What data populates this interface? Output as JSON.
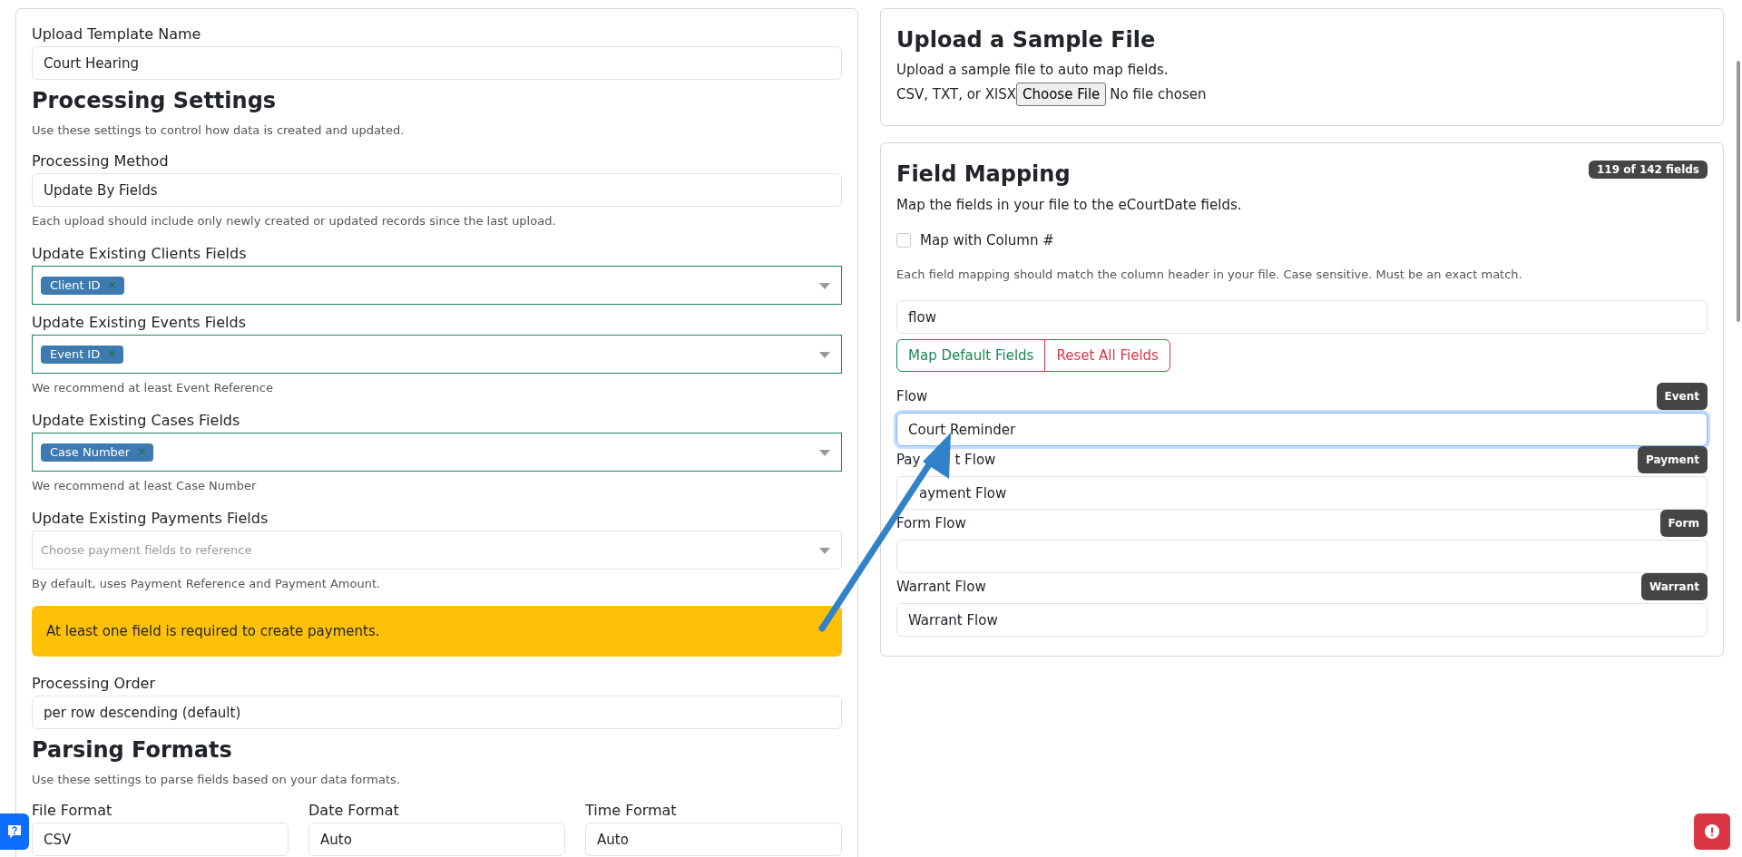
{
  "template_name": {
    "label": "Upload Template Name",
    "value": "Court Hearing"
  },
  "processing_settings": {
    "heading": "Processing Settings",
    "description": "Use these settings to control how data is created and updated.",
    "method": {
      "label": "Processing Method",
      "value": "Update By Fields",
      "help": "Each upload should include only newly created or updated records since the last upload."
    },
    "update_fields": [
      {
        "label": "Update Existing Clients Fields",
        "valid": true,
        "tags": [
          {
            "label": "Client ID",
            "remove": "×"
          }
        ]
      },
      {
        "label": "Update Existing Events Fields",
        "valid": true,
        "tags": [
          {
            "label": "Event ID",
            "remove": "×"
          }
        ],
        "help": "We recommend at least Event Reference"
      },
      {
        "label": "Update Existing Cases Fields",
        "valid": true,
        "tags": [
          {
            "label": "Case Number",
            "remove": "×"
          }
        ],
        "help": "We recommend at least Case Number"
      },
      {
        "label": "Update Existing Payments Fields",
        "valid": false,
        "placeholder": "Choose payment fields to reference",
        "help": "By default, uses Payment Reference and Payment Amount."
      }
    ],
    "alert": "At least one field is required to create payments.",
    "order": {
      "label": "Processing Order",
      "value": "per row descending (default)"
    }
  },
  "parsing_formats": {
    "heading": "Parsing Formats",
    "description": "Use these settings to parse fields based on your data formats.",
    "fields": [
      {
        "label": "File Format",
        "value": "CSV"
      },
      {
        "label": "Date Format",
        "value": "Auto"
      },
      {
        "label": "Time Format",
        "value": "Auto"
      }
    ]
  },
  "sample_file": {
    "heading": "Upload a Sample File",
    "description": "Upload a sample file to auto map fields.",
    "accepted": "CSV, TXT, or XlSX",
    "button": "Choose File",
    "status": "No file chosen"
  },
  "field_mapping": {
    "heading": "Field Mapping",
    "count": "119 of 142 fields",
    "description": "Map the fields in your file to the eCourtDate fields.",
    "column_checkbox": {
      "label": "Map with Column #",
      "checked": false
    },
    "note": "Each field mapping should match the column header in your file. Case sensitive. Must be an exact match.",
    "search": {
      "value": "flow"
    },
    "buttons": [
      {
        "label": "Map Default Fields",
        "kind": "default"
      },
      {
        "label": "Reset All Fields",
        "kind": "reset"
      }
    ],
    "fields": [
      {
        "label": "Flow",
        "category": "Event",
        "value": "Court Reminder",
        "focused": true
      },
      {
        "label_parts": [
          "Pay",
          "t Flow"
        ],
        "category": "Payment",
        "value": "ayment Flow",
        "focused": false
      },
      {
        "label": "Form Flow",
        "category": "Form",
        "focused": false
      },
      {
        "label": "Warrant Flow",
        "category": "Warrant",
        "value": "Warrant Flow",
        "focused": false
      }
    ]
  }
}
